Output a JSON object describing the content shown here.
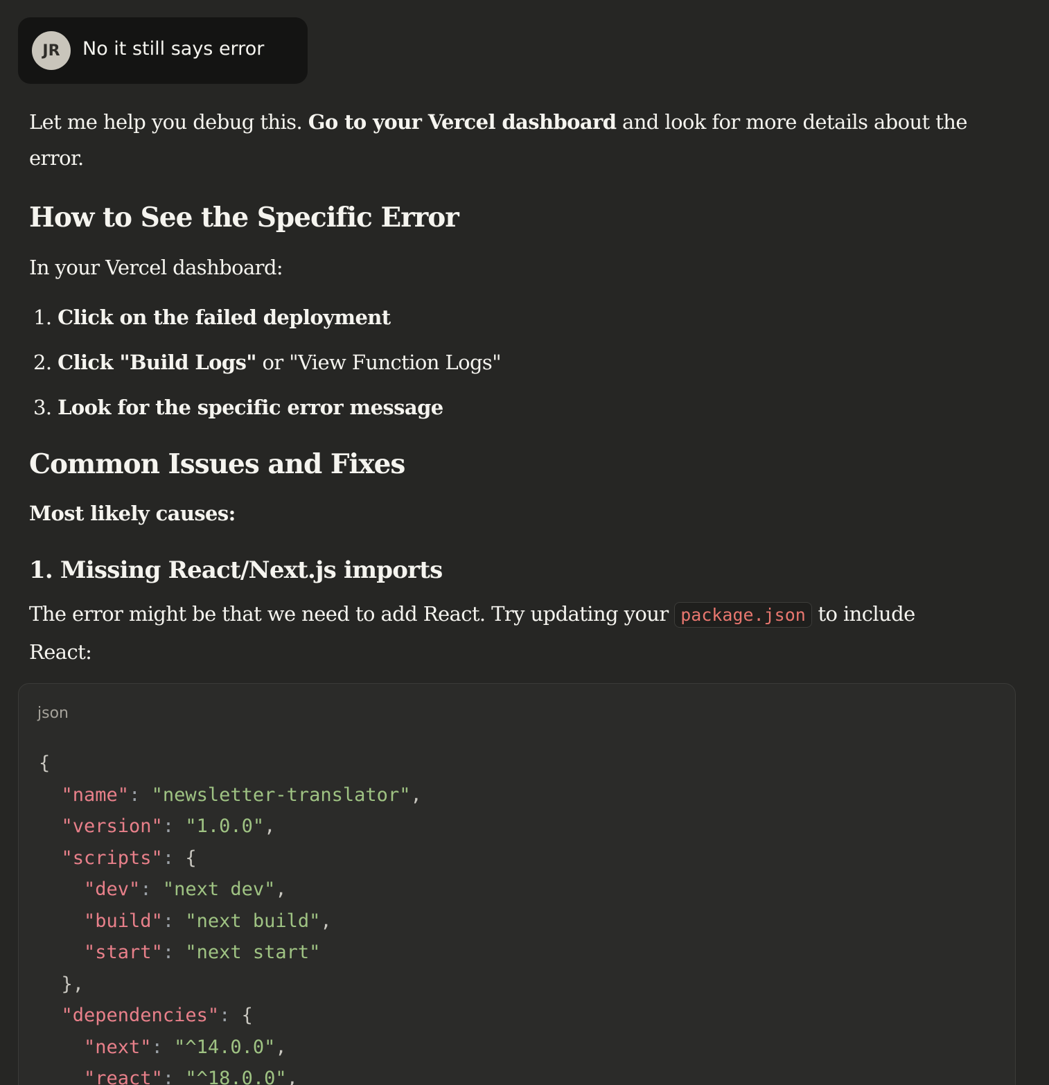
{
  "user_message": {
    "avatar_initials": "JR",
    "text": "No it still says error"
  },
  "response": {
    "intro_plain_1": "Let me help you debug this. ",
    "intro_bold": "Go to your Vercel dashboard",
    "intro_plain_2": " and look for more details about the error.",
    "heading_1": "How to See the Specific Error",
    "dashboard_line": "In your Vercel dashboard:",
    "steps": [
      {
        "number": "1.",
        "bold": "Click on the failed deployment",
        "rest": ""
      },
      {
        "number": "2.",
        "bold": "Click \"Build Logs\"",
        "rest": " or \"View Function Logs\""
      },
      {
        "number": "3.",
        "bold": "Look for the specific error message",
        "rest": ""
      }
    ],
    "heading_2": "Common Issues and Fixes",
    "causes_label": "Most likely causes:",
    "heading_3": "1. Missing React/Next.js imports",
    "para_plain_1": "The error might be that we need to add React. Try updating your ",
    "para_code": "package.json",
    "para_plain_2": " to include",
    "para_plain_3": "React:"
  },
  "code_block": {
    "language": "json",
    "lines": {
      "l1": "{",
      "name_key": "\"name\"",
      "name_val": "\"newsletter-translator\"",
      "version_key": "\"version\"",
      "version_val": "\"1.0.0\"",
      "scripts_key": "\"scripts\"",
      "dev_key": "\"dev\"",
      "dev_val": "\"next dev\"",
      "build_key": "\"build\"",
      "build_val": "\"next build\"",
      "start_key": "\"start\"",
      "start_val": "\"next start\"",
      "deps_key": "\"dependencies\"",
      "next_key": "\"next\"",
      "next_val": "\"^14.0.0\"",
      "react_key": "\"react\"",
      "react_val": "\"^18.0.0\""
    }
  }
}
